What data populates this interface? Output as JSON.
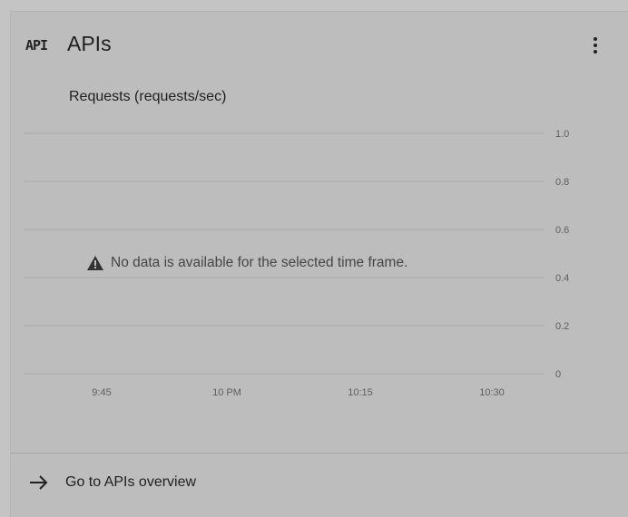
{
  "card": {
    "icon": "api-icon",
    "icon_text": "API",
    "title": "APIs",
    "menu_icon": "more-vert-icon"
  },
  "chart_data": {
    "type": "line",
    "title": "Requests (requests/sec)",
    "x_ticks": [
      "9:45",
      "10 PM",
      "10:15",
      "10:30"
    ],
    "y_ticks": [
      "1.0",
      "0.8",
      "0.6",
      "0.4",
      "0.2",
      "0"
    ],
    "ylim": [
      0,
      1.0
    ],
    "grid": true,
    "series": []
  },
  "empty_state": {
    "icon": "warning-icon",
    "message": "No data is available for the selected time frame."
  },
  "footer": {
    "icon": "arrow-right-icon",
    "link_label": "Go to APIs overview"
  }
}
